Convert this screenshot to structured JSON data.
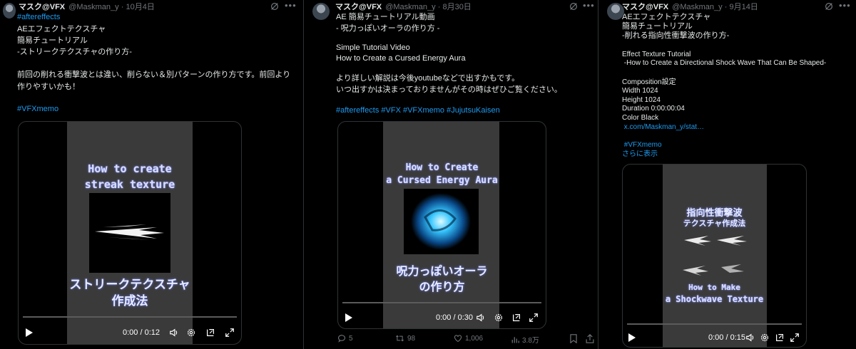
{
  "tweets": [
    {
      "name": "マスク@VFX",
      "handle": "@Maskman_y",
      "dot": "·",
      "date": "10月4日",
      "hashtag_top": "#aftereffects",
      "lines": [
        "AEエフェクトテクスチャ",
        "簡易チュートリアル",
        "-ストリークテクスチャの作り方-"
      ],
      "body": "前回の削れる衝撃波とは違い、削らない＆別パターンの作り方です。前回より作りやすいかも！",
      "hashtag_bottom": "#VFXmemo",
      "video": {
        "title_en_1": "How to create",
        "title_en_2": "streak texture",
        "title_jp_1": "ストリークテクスチャ",
        "title_jp_2": "作成法",
        "time": "0:00 / 0:12"
      }
    },
    {
      "name": "マスク@VFX",
      "handle": "@Maskman_y",
      "dot": "·",
      "date": "8月30日",
      "lines": [
        "AE 簡易チュートリアル動画",
        "- 呪力っぽいオーラの作り方 -",
        "",
        "Simple Tutorial Video",
        "How to Create a Cursed Energy Aura",
        "",
        "より詳しい解説は今後youtubeなどで出すかもです。",
        "いつ出すかは決まっておりませんがその時はぜひご覧ください。"
      ],
      "hashtags": "#aftereffects #VFX #VFXmemo #JujutsuKaisen",
      "video": {
        "title_en_1": "How to Create",
        "title_en_2": "a Cursed Energy Aura",
        "title_jp_1": "呪力っぽいオーラ",
        "title_jp_2": "の作り方",
        "time": "0:00 / 0:30"
      },
      "stats": {
        "replies": "5",
        "reposts": "98",
        "likes": "1,006",
        "views": "3.8万"
      }
    },
    {
      "name": "マスク@VFX",
      "handle": "@Maskman_y",
      "dot": "·",
      "date": "9月14日",
      "lines": [
        "AEエフェクトテクスチャ",
        "簡易チュートリアル",
        "-削れる指向性衝撃波の作り方-",
        "",
        "Effect Texture Tutorial",
        " -How to Create a Directional Shock Wave That Can Be Shaped-",
        "",
        "Composition設定",
        "Width 1024",
        "Height 1024",
        "Duration 0:00:00:04",
        "Color Black"
      ],
      "link": " x.com/Maskman_y/stat…",
      "hashtag": " #VFXmemo",
      "show_more": "さらに表示",
      "video": {
        "title_jp_1": "指向性衝撃波",
        "title_jp_2": "テクスチャ作成法",
        "title_en_1": "How to Make",
        "title_en_2": "a Shockwave Texture",
        "time": "0:00 / 0:15"
      }
    }
  ],
  "colors": {
    "link": "#1d9bf0",
    "muted": "#71767b",
    "background": "#000000"
  }
}
